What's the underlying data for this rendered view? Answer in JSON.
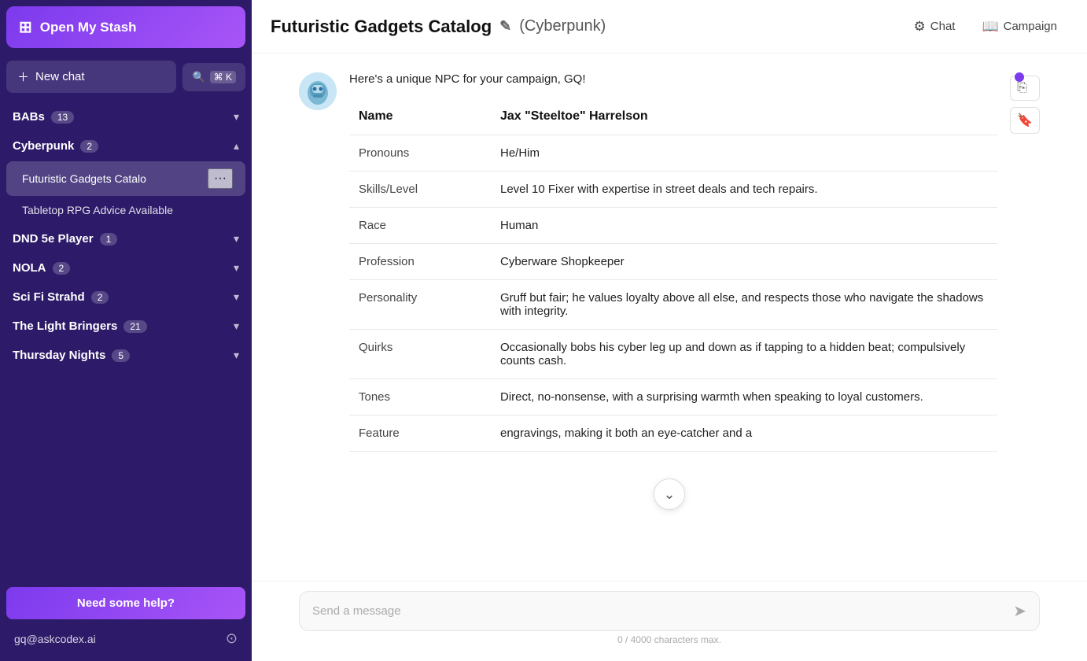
{
  "sidebar": {
    "open_stash_label": "Open My Stash",
    "new_chat_label": "New chat",
    "search_label": "⌘ K",
    "sections": [
      {
        "id": "babs",
        "title": "BABs",
        "badge": "13",
        "expanded": false,
        "items": []
      },
      {
        "id": "cyberpunk",
        "title": "Cyberpunk",
        "badge": "2",
        "expanded": true,
        "items": [
          {
            "id": "futuristic",
            "label": "Futuristic Gadgets Catalo",
            "active": true
          },
          {
            "id": "tabletop",
            "label": "Tabletop RPG Advice Available",
            "active": false
          }
        ]
      },
      {
        "id": "dnd5e",
        "title": "DND 5e Player",
        "badge": "1",
        "expanded": false,
        "items": []
      },
      {
        "id": "nola",
        "title": "NOLA",
        "badge": "2",
        "expanded": false,
        "items": []
      },
      {
        "id": "scifi",
        "title": "Sci Fi Strahd",
        "badge": "2",
        "expanded": false,
        "items": []
      },
      {
        "id": "lightbringers",
        "title": "The Light Bringers",
        "badge": "21",
        "expanded": false,
        "items": []
      },
      {
        "id": "thursday",
        "title": "Thursday Nights",
        "badge": "5",
        "expanded": false,
        "items": []
      }
    ],
    "help_label": "Need some help?",
    "user_email": "gq@askcodex.ai"
  },
  "header": {
    "title": "Futuristic Gadgets Catalog",
    "edit_icon": "✎",
    "tag": "(Cyberpunk)",
    "chat_label": "Chat",
    "campaign_label": "Campaign"
  },
  "chat": {
    "intro": "Here's a unique NPC for your campaign, GQ!",
    "npc": {
      "rows": [
        {
          "label": "Name",
          "value": "Jax \"Steeltoe\" Harrelson"
        },
        {
          "label": "Pronouns",
          "value": "He/Him"
        },
        {
          "label": "Skills/Level",
          "value": "Level 10 Fixer with expertise in street deals and tech repairs."
        },
        {
          "label": "Race",
          "value": "Human"
        },
        {
          "label": "Profession",
          "value": "Cyberware Shopkeeper"
        },
        {
          "label": "Personality",
          "value": "Gruff but fair; he values loyalty above all else, and respects those who navigate the shadows with integrity."
        },
        {
          "label": "Quirks",
          "value": "Occasionally bobs his cyber leg up and down as if tapping to a hidden beat; compulsively counts cash."
        },
        {
          "label": "Tones",
          "value": "Direct, no-nonsense, with a surprising warmth when speaking to loyal customers."
        },
        {
          "label": "Feature",
          "value": "engravings, making it both an eye-catcher and a"
        }
      ]
    },
    "input_placeholder": "Send a message",
    "char_count": "0 / 4000 characters max."
  }
}
